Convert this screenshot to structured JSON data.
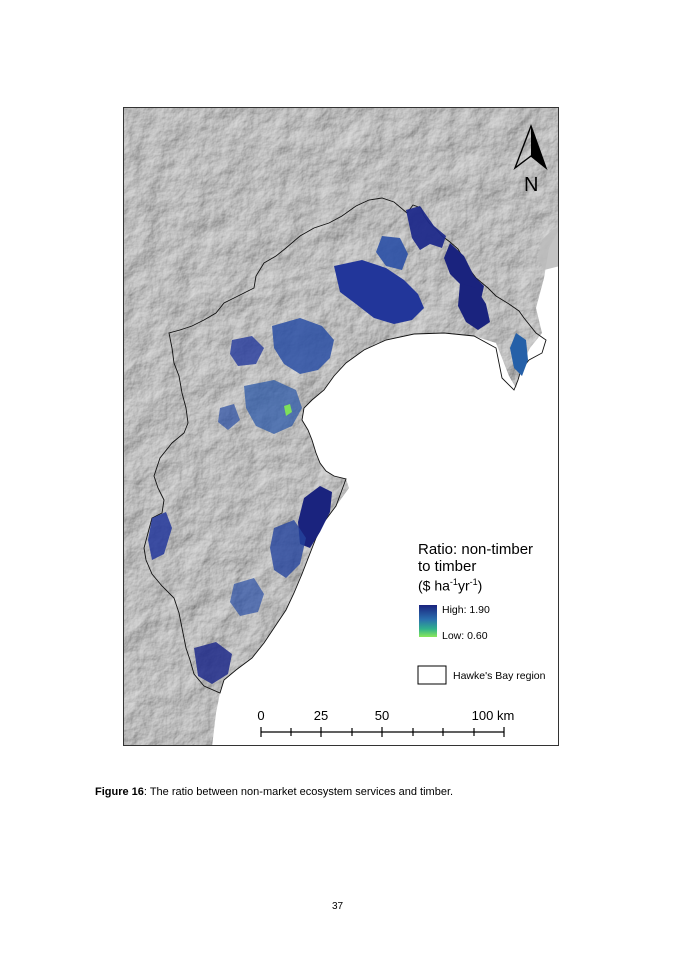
{
  "map": {
    "north_label": "N",
    "colors": {
      "hillshade": "#c9c9c9",
      "sea": "#ffffff",
      "boundary": "#111111",
      "high": "#1a237e",
      "mid": "#2a7ab8",
      "low": "#7ee05a"
    }
  },
  "legend": {
    "title_line1": "Ratio: non-timber",
    "title_line2": "to  timber",
    "units_prefix": "($ ha",
    "units_exp1": "-1",
    "units_mid": "yr",
    "units_exp2": "-1",
    "units_suffix": ")",
    "high_label": "High: 1.90",
    "low_label": "Low: 0.60",
    "region_label": "Hawke's Bay region"
  },
  "scale_bar": {
    "ticks": [
      "0",
      "25",
      "50",
      "100 km"
    ]
  },
  "caption": {
    "label": "Figure 16",
    "text": ": The ratio between non-market ecosystem services and timber."
  },
  "page_number": "37"
}
